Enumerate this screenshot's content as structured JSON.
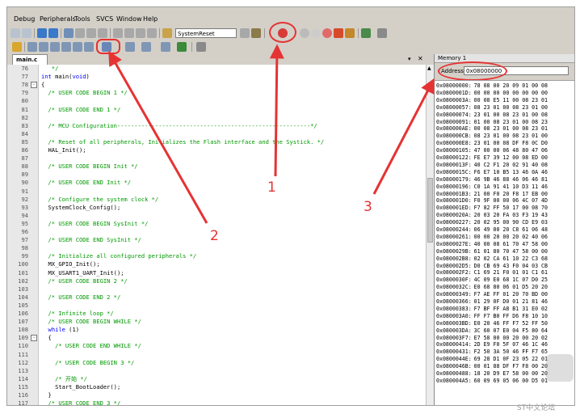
{
  "menubar": {
    "items": [
      "Debug",
      "Peripherals",
      "Tools",
      "SVCS",
      "Window",
      "Help"
    ]
  },
  "toolbar": {
    "target_name": "SystemReset"
  },
  "editor": {
    "tab_label": "main.c",
    "lines": [
      {
        "n": "76",
        "fold": "",
        "text": "   */",
        "cls": "cm"
      },
      {
        "n": "77",
        "fold": "",
        "text": "int main(void)",
        "cls": "kwline"
      },
      {
        "n": "78",
        "fold": "-",
        "text": "{",
        "cls": ""
      },
      {
        "n": "79",
        "fold": "",
        "text": "  /* USER CODE BEGIN 1 */",
        "cls": "cm"
      },
      {
        "n": "80",
        "fold": "",
        "text": "",
        "cls": ""
      },
      {
        "n": "81",
        "fold": "",
        "text": "  /* USER CODE END 1 */",
        "cls": "cm"
      },
      {
        "n": "82",
        "fold": "",
        "text": "",
        "cls": ""
      },
      {
        "n": "83",
        "fold": "",
        "text": "  /* MCU Configuration--------------------------------------------------------*/",
        "cls": "cm"
      },
      {
        "n": "84",
        "fold": "",
        "text": "",
        "cls": ""
      },
      {
        "n": "85",
        "fold": "",
        "text": "  /* Reset of all peripherals, Initializes the Flash interface and the Systick. */",
        "cls": "cm"
      },
      {
        "n": "86",
        "fold": "",
        "text": "  HAL_Init();",
        "cls": ""
      },
      {
        "n": "87",
        "fold": "",
        "text": "",
        "cls": ""
      },
      {
        "n": "88",
        "fold": "",
        "text": "  /* USER CODE BEGIN Init */",
        "cls": "cm"
      },
      {
        "n": "89",
        "fold": "",
        "text": "",
        "cls": ""
      },
      {
        "n": "90",
        "fold": "",
        "text": "  /* USER CODE END Init */",
        "cls": "cm"
      },
      {
        "n": "91",
        "fold": "",
        "text": "",
        "cls": ""
      },
      {
        "n": "92",
        "fold": "",
        "text": "  /* Configure the system clock */",
        "cls": "cm"
      },
      {
        "n": "93",
        "fold": "",
        "text": "  SystemClock_Config();",
        "cls": ""
      },
      {
        "n": "94",
        "fold": "",
        "text": "",
        "cls": ""
      },
      {
        "n": "95",
        "fold": "",
        "text": "  /* USER CODE BEGIN SysInit */",
        "cls": "cm"
      },
      {
        "n": "96",
        "fold": "",
        "text": "",
        "cls": ""
      },
      {
        "n": "97",
        "fold": "",
        "text": "  /* USER CODE END SysInit */",
        "cls": "cm"
      },
      {
        "n": "98",
        "fold": "",
        "text": "",
        "cls": ""
      },
      {
        "n": "99",
        "fold": "",
        "text": "  /* Initialize all configured peripherals */",
        "cls": "cm"
      },
      {
        "n": "100",
        "fold": "",
        "text": "  MX_GPIO_Init();",
        "cls": ""
      },
      {
        "n": "101",
        "fold": "",
        "text": "  MX_USART1_UART_Init();",
        "cls": ""
      },
      {
        "n": "102",
        "fold": "",
        "text": "  /* USER CODE BEGIN 2 */",
        "cls": "cm"
      },
      {
        "n": "103",
        "fold": "",
        "text": "",
        "cls": ""
      },
      {
        "n": "104",
        "fold": "",
        "text": "  /* USER CODE END 2 */",
        "cls": "cm"
      },
      {
        "n": "105",
        "fold": "",
        "text": "",
        "cls": ""
      },
      {
        "n": "106",
        "fold": "",
        "text": "  /* Infinite loop */",
        "cls": "cm"
      },
      {
        "n": "107",
        "fold": "",
        "text": "  /* USER CODE BEGIN WHILE */",
        "cls": "cm"
      },
      {
        "n": "108",
        "fold": "",
        "text": "  while (1)",
        "cls": "kwline"
      },
      {
        "n": "109",
        "fold": "-",
        "text": "  {",
        "cls": ""
      },
      {
        "n": "110",
        "fold": "",
        "text": "    /* USER CODE END WHILE */",
        "cls": "cm"
      },
      {
        "n": "111",
        "fold": "",
        "text": "",
        "cls": ""
      },
      {
        "n": "112",
        "fold": "",
        "text": "    /* USER CODE BEGIN 3 */",
        "cls": "cm"
      },
      {
        "n": "113",
        "fold": "",
        "text": "",
        "cls": ""
      },
      {
        "n": "114",
        "fold": "",
        "text": "    /* 开始 */",
        "cls": "cm"
      },
      {
        "n": "115",
        "fold": "",
        "text": "    Start_BootLoader();",
        "cls": ""
      },
      {
        "n": "116",
        "fold": "",
        "text": "  }",
        "cls": ""
      },
      {
        "n": "117",
        "fold": "",
        "text": "  /* USER CODE END 3 */",
        "cls": "cm"
      },
      {
        "n": "118",
        "fold": "",
        "text": "}",
        "cls": ""
      }
    ]
  },
  "memory": {
    "title": "Memory 1",
    "address_label": "Address:",
    "address_value": "0x08000000",
    "rows": [
      {
        "addr": "0x08000000:",
        "bytes": "78 08 00 20 09 01 00 08"
      },
      {
        "addr": "0x0800001D:",
        "bytes": "00 00 00 00 00 00 00 00"
      },
      {
        "addr": "0x0800003A:",
        "bytes": "00 08 E5 11 00 08 23 01"
      },
      {
        "addr": "0x08000057:",
        "bytes": "08 23 01 00 08 23 01 00"
      },
      {
        "addr": "0x08000074:",
        "bytes": "23 01 00 08 23 01 00 08"
      },
      {
        "addr": "0x08000091:",
        "bytes": "01 00 08 23 01 00 08 23"
      },
      {
        "addr": "0x080000AE:",
        "bytes": "00 08 23 01 00 08 23 01"
      },
      {
        "addr": "0x080000CB:",
        "bytes": "08 23 01 00 08 23 01 00"
      },
      {
        "addr": "0x080000E8:",
        "bytes": "23 01 00 08 DF F8 0C D0"
      },
      {
        "addr": "0x08000105:",
        "bytes": "47 00 00 06 48 80 47 06"
      },
      {
        "addr": "0x08000122:",
        "bytes": "FE E7 39 12 00 08 ED 00"
      },
      {
        "addr": "0x0800013F:",
        "bytes": "40 C2 F1 20 02 91 40 08"
      },
      {
        "addr": "0x0800015C:",
        "bytes": "F6 E7 10 B5 13 46 0A 46"
      },
      {
        "addr": "0x08000179:",
        "bytes": "46 9B 46 88 46 06 46 81"
      },
      {
        "addr": "0x08000196:",
        "bytes": "C0 1A 91 41 10 D3 11 46"
      },
      {
        "addr": "0x080001B3:",
        "bytes": "21 00 F0 20 F8 17 EB 00"
      },
      {
        "addr": "0x080001D0:",
        "bytes": "F0 9F 00 00 06 4C 07 4D"
      },
      {
        "addr": "0x080001ED:",
        "bytes": "F7 82 FF 50 17 00 08 70"
      },
      {
        "addr": "0x0800020A:",
        "bytes": "20 03 20 FA 03 F3 19 43"
      },
      {
        "addr": "0x08000227:",
        "bytes": "20 02 95 00 90 CD E9 03"
      },
      {
        "addr": "0x08000244:",
        "bytes": "06 49 00 20 C8 61 06 48"
      },
      {
        "addr": "0x08000261:",
        "bytes": "00 00 20 00 20 02 40 06"
      },
      {
        "addr": "0x0800027E:",
        "bytes": "40 00 08 61 70 47 58 00"
      },
      {
        "addr": "0x0800029B:",
        "bytes": "61 01 80 70 47 58 00 00"
      },
      {
        "addr": "0x080002B8:",
        "bytes": "02 02 CA 61 10 22 C3 68"
      },
      {
        "addr": "0x080002D5:",
        "bytes": "D0 CB 69 43 F0 04 03 CB"
      },
      {
        "addr": "0x080002F2:",
        "bytes": "C1 69 21 F0 01 01 C1 61"
      },
      {
        "addr": "0x0800030F:",
        "bytes": "4C 09 E0 68 1C 07 D0 25"
      },
      {
        "addr": "0x0800032C:",
        "bytes": "E0 68 80 06 01 D5 20 20"
      },
      {
        "addr": "0x08000349:",
        "bytes": "F7 AE FF 01 20 70 BD 00"
      },
      {
        "addr": "0x08000366:",
        "bytes": "01 29 0F D0 01 21 81 46"
      },
      {
        "addr": "0x08000383:",
        "bytes": "F7 BF FF A8 B1 31 E0 02"
      },
      {
        "addr": "0x080003A0:",
        "bytes": "FF F7 B0 FF D6 F8 10 10"
      },
      {
        "addr": "0x080003BD:",
        "bytes": "E0 20 46 FF F7 52 FF 50"
      },
      {
        "addr": "0x080003DA:",
        "bytes": "3C 60 07 E0 04 F5 80 64"
      },
      {
        "addr": "0x080003F7:",
        "bytes": "E7 58 00 00 20 00 20 02"
      },
      {
        "addr": "0x08000414:",
        "bytes": "2D E9 F0 5F 07 46 1C 46"
      },
      {
        "addr": "0x08000431:",
        "bytes": "F2 50 3A 50 46 FF F7 65"
      },
      {
        "addr": "0x0800044E:",
        "bytes": "69 28 D1 0F 23 05 22 01"
      },
      {
        "addr": "0x0800046B:",
        "bytes": "00 01 88 DF F7 F8 00 20"
      },
      {
        "addr": "0x08000488:",
        "bytes": "18 20 D9 E7 58 00 00 20"
      },
      {
        "addr": "0x080004A5:",
        "bytes": "60 09 69 05 06 00 D5 01"
      }
    ]
  },
  "annotations": {
    "labels": [
      "1",
      "2",
      "3"
    ],
    "color": "#e53333"
  },
  "watermark": "ST中文论坛"
}
